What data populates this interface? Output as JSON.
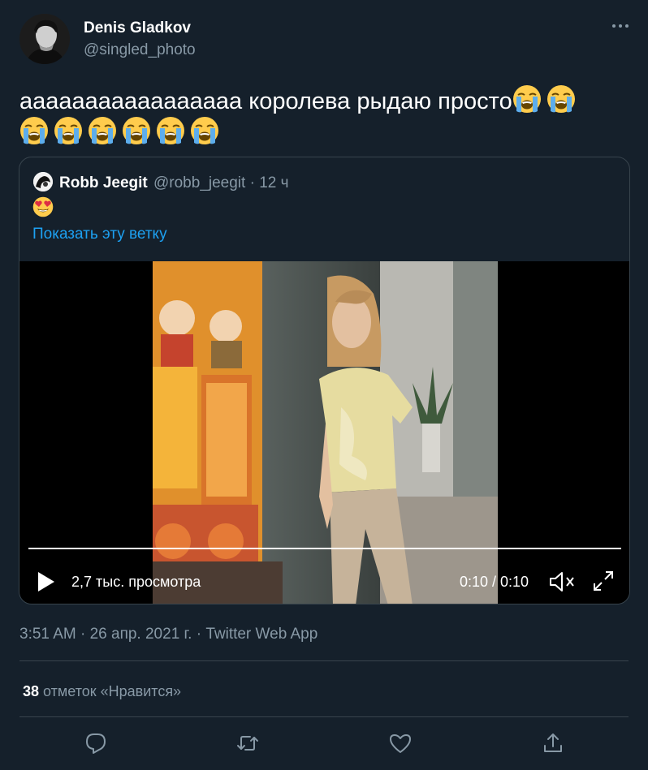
{
  "author": {
    "name": "Denis Gladkov",
    "handle": "@singled_photo",
    "more_icon": "more-horizontal-icon"
  },
  "tweet": {
    "text": "ааааааааааааааааа королева рыдаю просто",
    "emoji": "loudly-crying-face",
    "emoji_count": 8
  },
  "quoted_tweet": {
    "name": "Robb Jeegit",
    "meta": "@robb_jeegit · 12 ч",
    "emoji": "smiling-face-with-heart-eyes",
    "show_thread": "Показать эту ветку",
    "video": {
      "views": "2,7 тыс. просмотра",
      "time": "0:10 / 0:10",
      "progress": 1.0
    }
  },
  "timestamp": {
    "date": "3:51 AM · 26 апр. 2021 г. · ",
    "app": "Twitter Web App"
  },
  "likes": {
    "count": "38",
    "label": "отметок «Нравится»"
  },
  "actions": [
    "reply-icon",
    "retweet-icon",
    "like-icon",
    "share-icon"
  ],
  "colors": {
    "background": "#15202b",
    "muted": "#8899a6",
    "link": "#1da1f2",
    "border": "#38444d"
  }
}
